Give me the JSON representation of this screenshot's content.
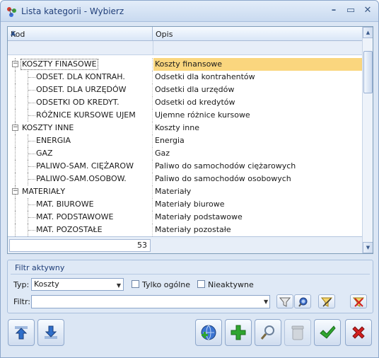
{
  "window": {
    "title": "Lista kategorii - Wybierz",
    "minimize_glyph": "–",
    "maximize_glyph": "▭",
    "close_glyph": "✕"
  },
  "grid": {
    "columns": {
      "kod": "Kod",
      "opis": "Opis"
    },
    "sort_indicator": "▲",
    "rows": [
      {
        "kod": "KOSZTY FINASOWE",
        "opis": "Koszty finansowe",
        "level": 0,
        "expander": "−",
        "selected": true
      },
      {
        "kod": "ODSET. DLA KONTRAH.",
        "opis": "Odsetki dla kontrahentów",
        "level": 1
      },
      {
        "kod": "ODSET. DLA URZĘDÓW",
        "opis": "Odsetki dla urzędów",
        "level": 1
      },
      {
        "kod": "ODSETKI OD KREDYT.",
        "opis": "Odsetki od kredytów",
        "level": 1
      },
      {
        "kod": "RÓŻNICE KURSOWE UJEM",
        "opis": "Ujemne różnice kursowe",
        "level": 1
      },
      {
        "kod": "KOSZTY INNE",
        "opis": "Koszty inne",
        "level": 0,
        "expander": "−"
      },
      {
        "kod": "ENERGIA",
        "opis": "Energia",
        "level": 1
      },
      {
        "kod": "GAZ",
        "opis": "Gaz",
        "level": 1
      },
      {
        "kod": "PALIWO-SAM. CIĘŻAROW",
        "opis": "Paliwo do samochodów ciężarowych",
        "level": 1
      },
      {
        "kod": "PALIWO-SAM.OSOBOW.",
        "opis": "Paliwo do samochodów osobowych",
        "level": 1
      },
      {
        "kod": "MATERIAŁY",
        "opis": "Materiały",
        "level": 0,
        "expander": "−"
      },
      {
        "kod": "MAT. BIUROWE",
        "opis": "Materiały biurowe",
        "level": 1
      },
      {
        "kod": "MAT. PODSTAWOWE",
        "opis": "Materiały podstawowe",
        "level": 1
      },
      {
        "kod": "MAT. POZOSTAŁE",
        "opis": "Materiały pozostałe",
        "level": 1
      }
    ],
    "record_count": "53",
    "scroll_up_glyph": "▲",
    "scroll_down_glyph": "▼"
  },
  "filter_panel": {
    "title": "Filtr aktywny",
    "type_label": "Typ:",
    "type_value": "Koszty",
    "type_arrow": "▼",
    "only_general_label": "Tylko ogólne",
    "only_general_checked": false,
    "inactive_label": "Nieaktywne",
    "inactive_checked": false,
    "filter_label": "Filtr:",
    "filter_value": ""
  },
  "toolbar": {
    "left_buttons": [
      "move-up-icon",
      "move-down-icon"
    ],
    "right_buttons": [
      "globe-add-icon",
      "add-icon",
      "edit-icon",
      "delete-icon",
      "confirm-icon",
      "cancel-icon"
    ]
  },
  "colors": {
    "selection": "#fad67e",
    "accent": "#21407a",
    "confirm": "#2fa52f",
    "cancel": "#d21f1f"
  }
}
